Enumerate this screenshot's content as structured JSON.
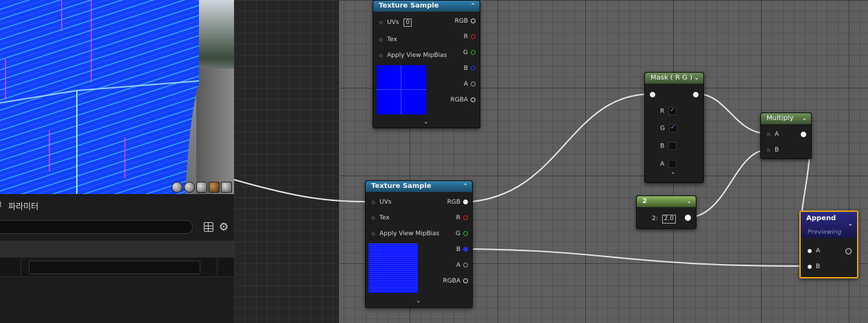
{
  "details": {
    "tab_label": "파라미터",
    "search_value": "",
    "field_value": ""
  },
  "viewport": {
    "preview_shapes": [
      "cylinder-icon",
      "sphere-icon",
      "plane-icon",
      "cube-icon",
      "custom-mesh-icon"
    ]
  },
  "nodes": {
    "texture_sample_1": {
      "title": "Texture Sample",
      "uvs_label": "UVs",
      "uvs_value": "0",
      "tex_label": "Tex",
      "mip_label": "Apply View MipBias",
      "outputs": [
        "RGB",
        "R",
        "G",
        "B",
        "A",
        "RGBA"
      ]
    },
    "texture_sample_2": {
      "title": "Texture Sample",
      "uvs_label": "UVs",
      "tex_label": "Tex",
      "mip_label": "Apply View MipBias",
      "outputs": [
        "RGB",
        "R",
        "G",
        "B",
        "A",
        "RGBA"
      ]
    },
    "mask": {
      "title": "Mask ( R G )",
      "channels": [
        {
          "label": "R",
          "checked": true
        },
        {
          "label": "G",
          "checked": true
        },
        {
          "label": "B",
          "checked": false
        },
        {
          "label": "A",
          "checked": false
        }
      ]
    },
    "multiply": {
      "title": "Multiply",
      "a_label": "A",
      "b_label": "B"
    },
    "constant2": {
      "title": "2",
      "param_label": "2:",
      "param_value": "2.0"
    },
    "append": {
      "title": "Append",
      "subtitle": "Previewing",
      "a_label": "A",
      "b_label": "B"
    }
  },
  "colors": {
    "pin_r": "#e02020",
    "pin_g": "#20c020",
    "pin_b": "#2030ff",
    "append_border": "#e8a317"
  }
}
